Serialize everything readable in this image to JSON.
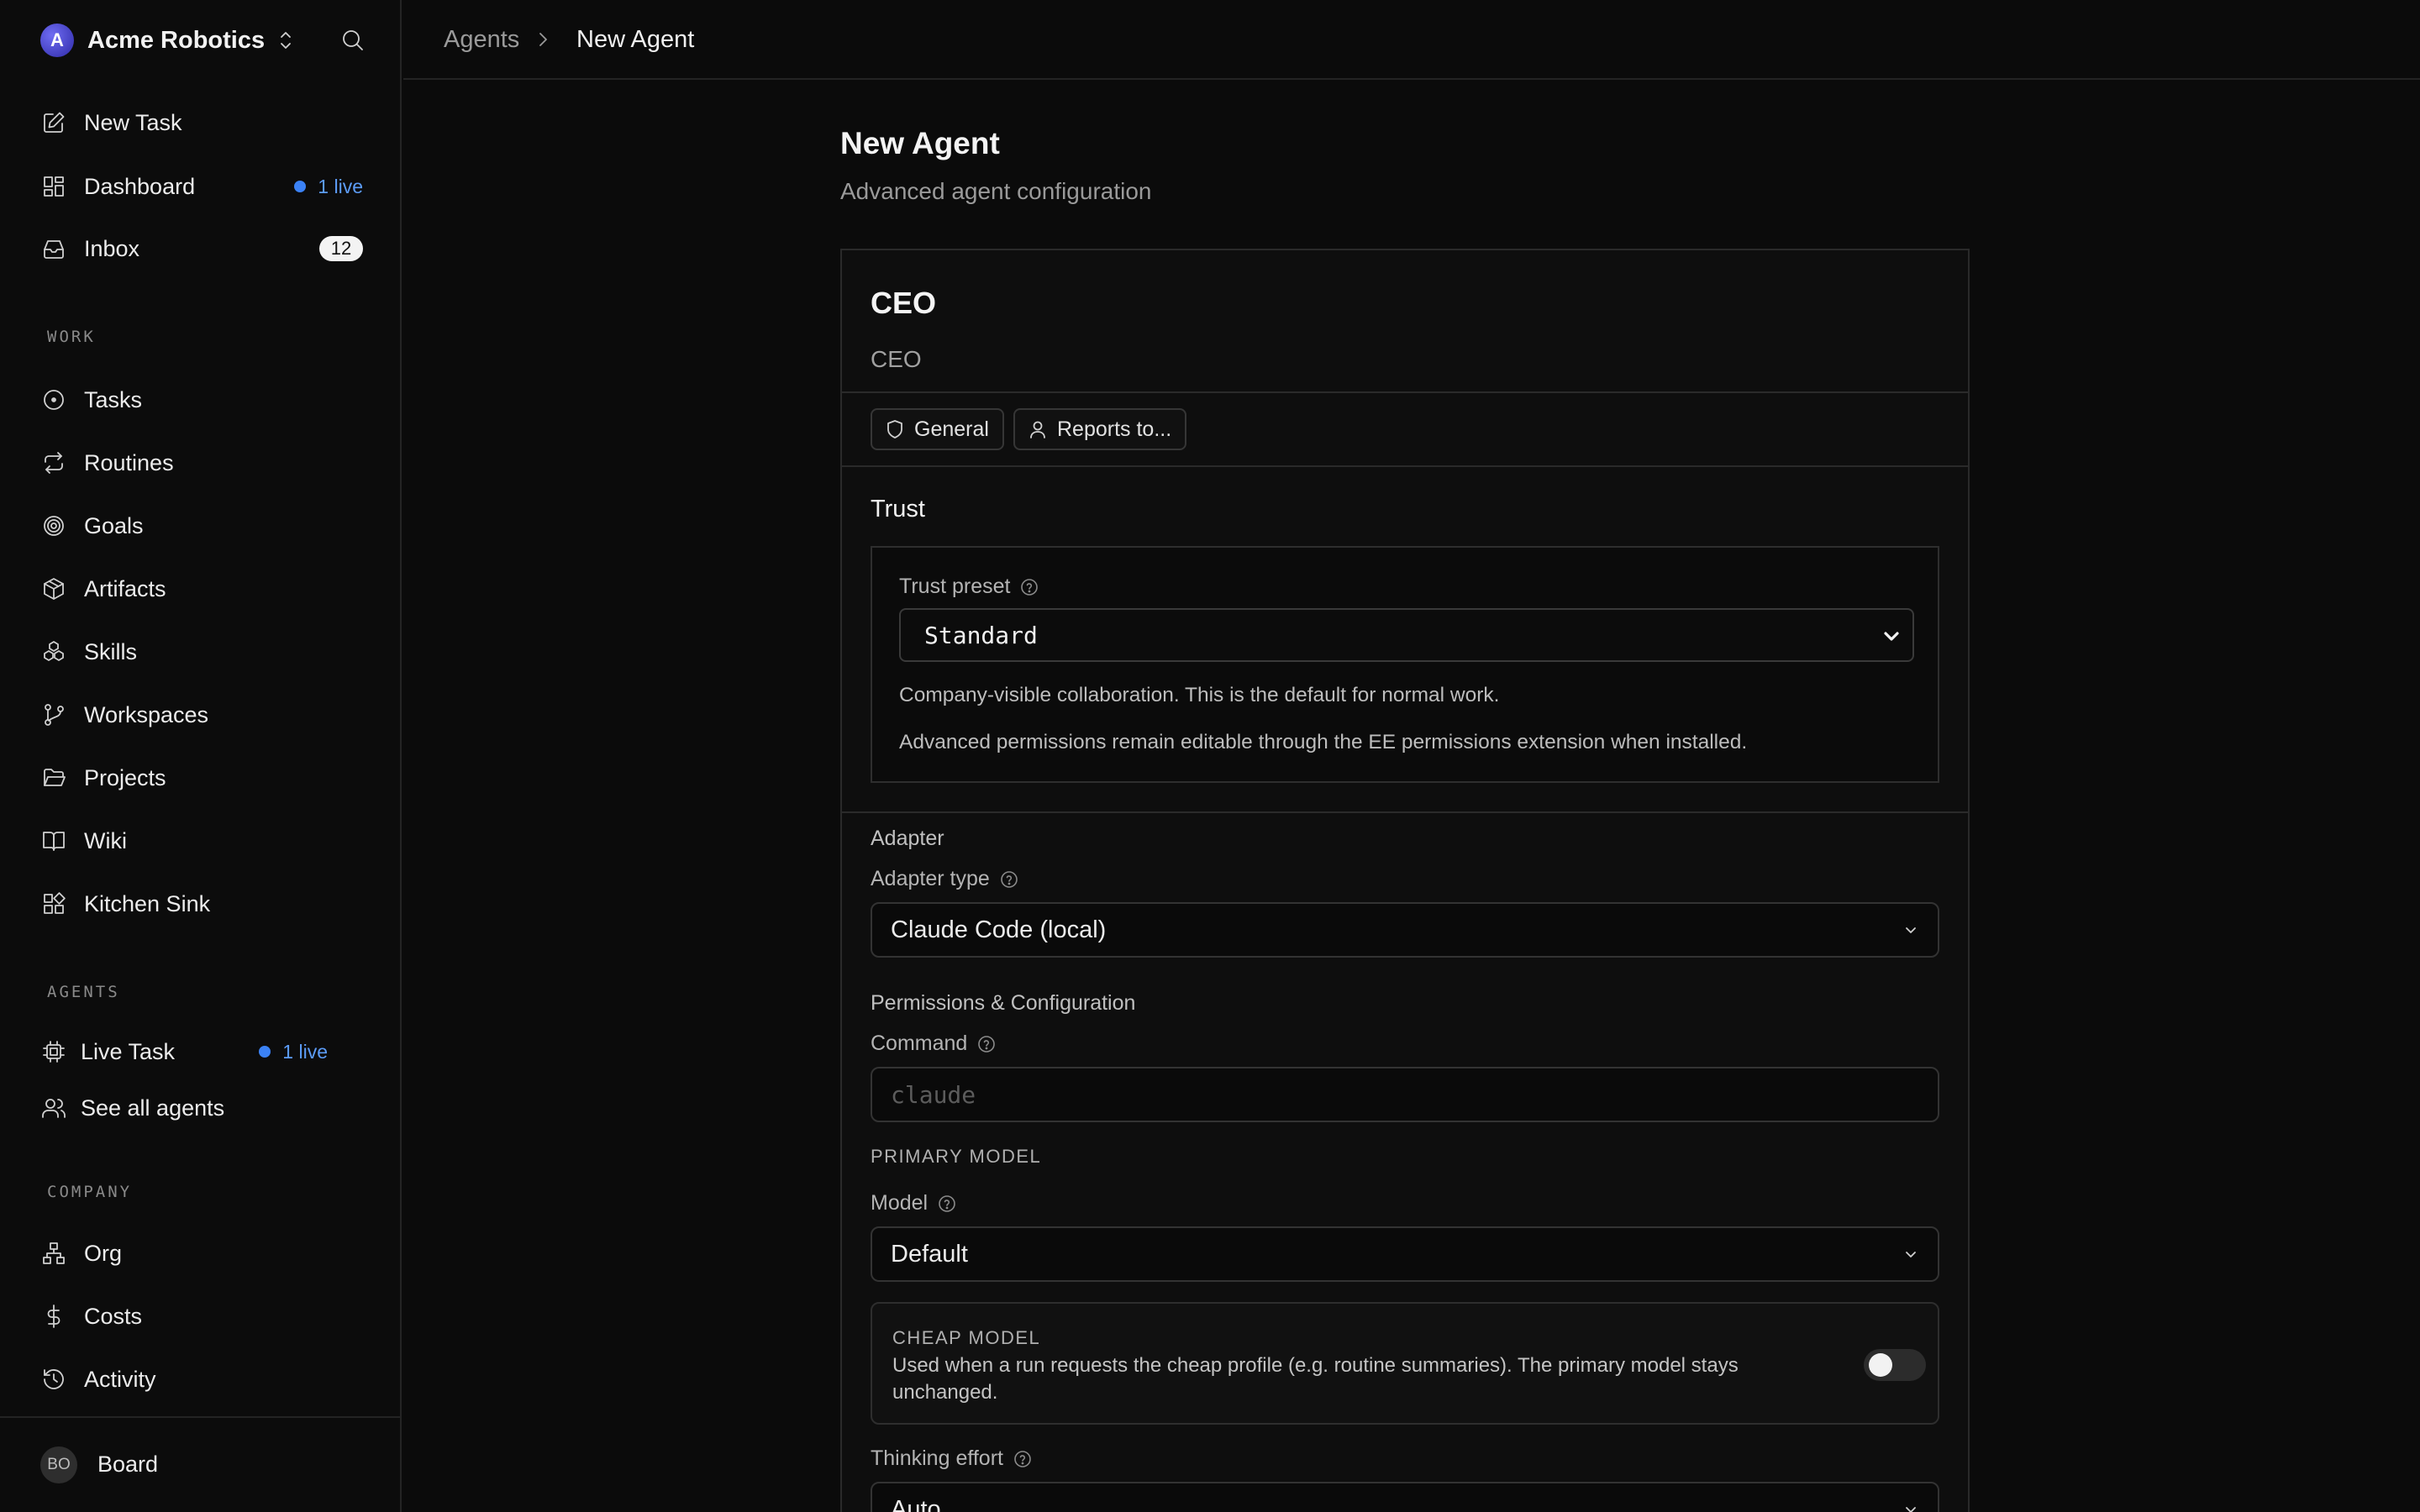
{
  "sidebar": {
    "brand": {
      "initial": "A",
      "name": "Acme Robotics"
    },
    "top_items": [
      {
        "label": "New Task"
      },
      {
        "label": "Dashboard",
        "badge": "1 live"
      },
      {
        "label": "Inbox",
        "count": "12"
      }
    ],
    "sections": {
      "work": "WORK",
      "agents": "AGENTS",
      "company": "COMPANY"
    },
    "work_items": [
      {
        "label": "Tasks"
      },
      {
        "label": "Routines"
      },
      {
        "label": "Goals"
      },
      {
        "label": "Artifacts"
      },
      {
        "label": "Skills"
      },
      {
        "label": "Workspaces"
      },
      {
        "label": "Projects"
      },
      {
        "label": "Wiki"
      },
      {
        "label": "Kitchen Sink"
      }
    ],
    "agent_items": [
      {
        "label": "Live Task",
        "badge": "1 live"
      },
      {
        "label": "See all agents"
      }
    ],
    "company_items": [
      {
        "label": "Org"
      },
      {
        "label": "Costs"
      },
      {
        "label": "Activity"
      }
    ],
    "footer": {
      "initials": "BO",
      "name": "Board"
    }
  },
  "breadcrumb": [
    "Agents",
    "New Agent"
  ],
  "page": {
    "title": "New Agent",
    "subtitle": "Advanced agent configuration"
  },
  "agent": {
    "name": "CEO",
    "role": "CEO",
    "chips": [
      "General",
      "Reports to..."
    ]
  },
  "trust": {
    "heading": "Trust",
    "preset_label": "Trust preset",
    "preset_value": "Standard",
    "desc_1": "Company-visible collaboration. This is the default for normal work.",
    "desc_2": "Advanced permissions remain editable through the EE permissions extension when installed."
  },
  "adapter": {
    "heading": "Adapter",
    "type_label": "Adapter type",
    "type_value": "Claude Code (local)"
  },
  "permissions": {
    "heading": "Permissions & Configuration",
    "command_label": "Command",
    "command_placeholder": "claude",
    "primary_model_heading": "PRIMARY MODEL",
    "model_label": "Model",
    "model_value": "Default",
    "cheap_model_title": "CHEAP MODEL",
    "cheap_model_desc": "Used when a run requests the cheap profile (e.g. routine summaries). The primary model stays unchanged.",
    "cheap_model_enabled": false,
    "thinking_label": "Thinking effort",
    "thinking_value": "Auto"
  }
}
